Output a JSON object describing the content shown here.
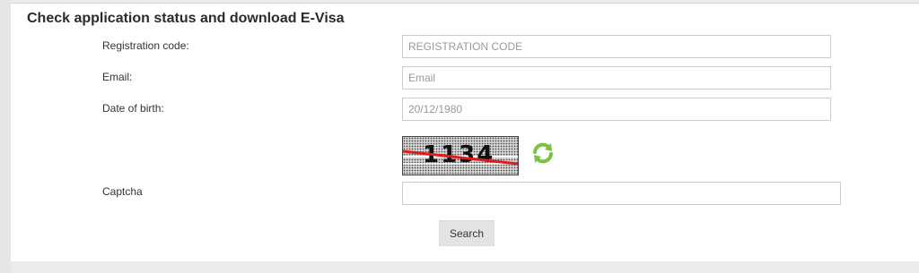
{
  "form": {
    "title": "Check application status and download E-Visa",
    "registration_code": {
      "label": "Registration code:",
      "placeholder": "REGISTRATION CODE",
      "value": ""
    },
    "email": {
      "label": "Email:",
      "placeholder": "Email",
      "value": ""
    },
    "date_of_birth": {
      "label": "Date of birth:",
      "placeholder": "20/12/1980",
      "value": ""
    },
    "captcha": {
      "label": "Captcha",
      "image_text": "1134",
      "value": ""
    },
    "search_label": "Search"
  },
  "colors": {
    "background": "#ebebeb",
    "panel": "#ffffff",
    "field_border": "#cccccc",
    "button": "#e3e3e3",
    "refresh_icon": "#7cc242",
    "captcha_strike": "#e01b1b"
  },
  "icons": {
    "refresh": "refresh-icon"
  }
}
